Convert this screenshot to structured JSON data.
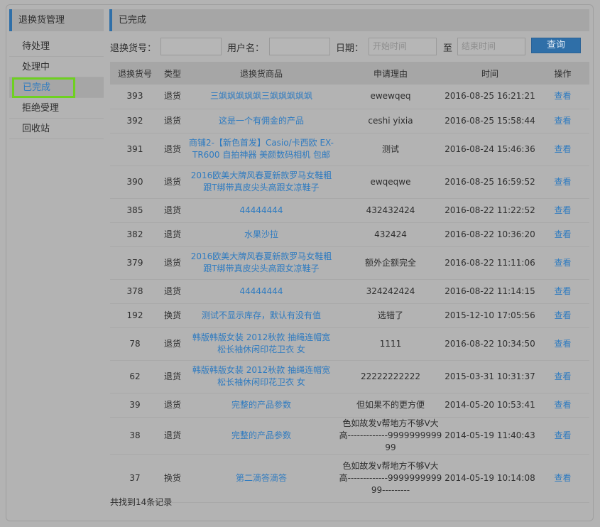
{
  "sidebar": {
    "title": "退换货管理",
    "items": [
      {
        "label": "待处理"
      },
      {
        "label": "处理中"
      },
      {
        "label": "已完成"
      },
      {
        "label": "拒绝受理"
      },
      {
        "label": "回收站"
      }
    ]
  },
  "main": {
    "title": "已完成"
  },
  "search": {
    "order_label": "退换货号：",
    "order_value": "",
    "user_label": "用户名：",
    "user_value": "",
    "date_label": "日期：",
    "start_placeholder": "开始时间",
    "to_label": "至",
    "end_placeholder": "结束时间",
    "query_button": "查询"
  },
  "table": {
    "headers": [
      "退换货号",
      "类型",
      "退换货商品",
      "申请理由",
      "时间",
      "操作"
    ],
    "rows": [
      {
        "id": "393",
        "type": "退货",
        "product": "三飒飒飒飒飒三飒飒飒飒飒",
        "reason": "ewewqeq",
        "time": "2016-08-25 16:21:21",
        "action": "查看"
      },
      {
        "id": "392",
        "type": "退货",
        "product": "这是一个有佣金的产品",
        "reason": "ceshi yixia",
        "time": "2016-08-25 15:58:44",
        "action": "查看"
      },
      {
        "id": "391",
        "type": "退货",
        "product": "商铺2-【新色首发】Casio/卡西欧 EX-TR600 自拍神器 美颜数码相机 包邮",
        "reason": "测试",
        "time": "2016-08-24 15:46:36",
        "action": "查看"
      },
      {
        "id": "390",
        "type": "退货",
        "product": "2016欧美大牌风春夏新款罗马女鞋粗跟T绑带真皮尖头高跟女凉鞋子",
        "reason": "ewqeqwe",
        "time": "2016-08-25 16:59:52",
        "action": "查看"
      },
      {
        "id": "385",
        "type": "退货",
        "product": "44444444",
        "reason": "432432424",
        "time": "2016-08-22 11:22:52",
        "action": "查看"
      },
      {
        "id": "382",
        "type": "退货",
        "product": "水果沙拉",
        "reason": "432424",
        "time": "2016-08-22 10:36:20",
        "action": "查看"
      },
      {
        "id": "379",
        "type": "退货",
        "product": "2016欧美大牌风春夏新款罗马女鞋粗跟T绑带真皮尖头高跟女凉鞋子",
        "reason": "额外企额完全",
        "time": "2016-08-22 11:11:06",
        "action": "查看"
      },
      {
        "id": "378",
        "type": "退货",
        "product": "44444444",
        "reason": "324242424",
        "time": "2016-08-22 11:14:15",
        "action": "查看"
      },
      {
        "id": "192",
        "type": "换货",
        "product": "测试不显示库存，默认有没有值",
        "reason": "选错了",
        "time": "2015-12-10 17:05:56",
        "action": "查看"
      },
      {
        "id": "78",
        "type": "退货",
        "product": "韩版韩版女装 2012秋款 抽绳连帽宽松长袖休闲印花卫衣 女",
        "reason": "1111",
        "time": "2016-08-22 10:34:50",
        "action": "查看"
      },
      {
        "id": "62",
        "type": "退货",
        "product": "韩版韩版女装 2012秋款 抽绳连帽宽松长袖休闲印花卫衣 女",
        "reason": "22222222222",
        "time": "2015-03-31 10:31:37",
        "action": "查看"
      },
      {
        "id": "39",
        "type": "退货",
        "product": "完整的产品参数",
        "reason": "但如果不的更方便",
        "time": "2014-05-20 10:53:41",
        "action": "查看"
      },
      {
        "id": "38",
        "type": "退货",
        "product": "完整的产品参数",
        "reason": "色如故发v帮地方不够V大高-------------999999999999",
        "time": "2014-05-19 11:40:43",
        "action": "查看"
      },
      {
        "id": "37",
        "type": "换货",
        "product": "第二滴答滴答",
        "reason": "色如故发v帮地方不够V大高-------------999999999999---------",
        "time": "2014-05-19 10:14:08",
        "action": "查看"
      }
    ]
  },
  "footer": {
    "summary": "共找到14条记录"
  },
  "colors": {
    "accent": "#2f6fa8",
    "link": "#2f7bc0",
    "highlight": "#6ed120"
  }
}
